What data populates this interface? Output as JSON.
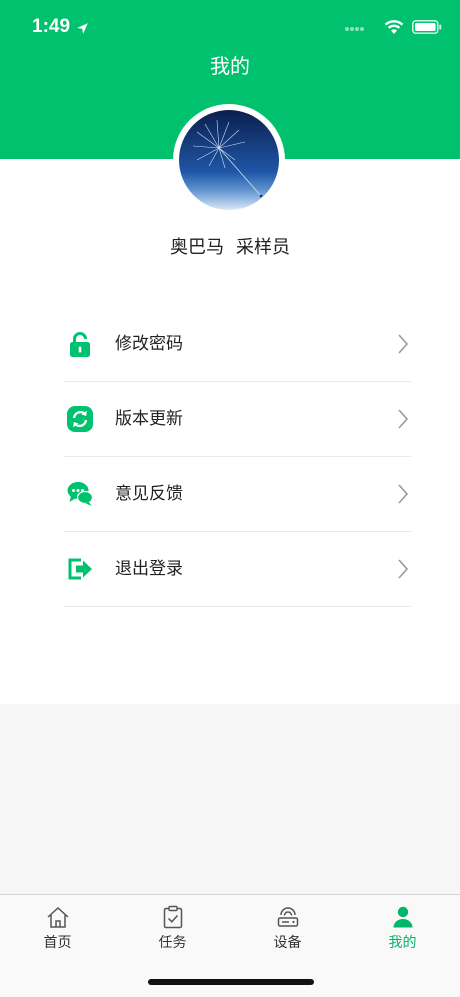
{
  "status_bar": {
    "time": "1:49"
  },
  "header": {
    "title": "我的"
  },
  "profile": {
    "name": "奥巴马",
    "role": "采样员"
  },
  "menu": {
    "items": [
      {
        "label": "修改密码",
        "icon": "lock-icon"
      },
      {
        "label": "版本更新",
        "icon": "refresh-icon"
      },
      {
        "label": "意见反馈",
        "icon": "chat-bubbles-icon"
      },
      {
        "label": "退出登录",
        "icon": "logout-icon"
      }
    ]
  },
  "tabbar": {
    "tabs": [
      {
        "label": "首页",
        "icon": "home-icon",
        "active": false
      },
      {
        "label": "任务",
        "icon": "clipboard-check-icon",
        "active": false
      },
      {
        "label": "设备",
        "icon": "device-icon",
        "active": false
      },
      {
        "label": "我的",
        "icon": "person-icon",
        "active": true
      }
    ]
  },
  "colors": {
    "accent": "#00c16e",
    "active_tab": "#00b66a",
    "background_gray": "#f6f6f6"
  }
}
